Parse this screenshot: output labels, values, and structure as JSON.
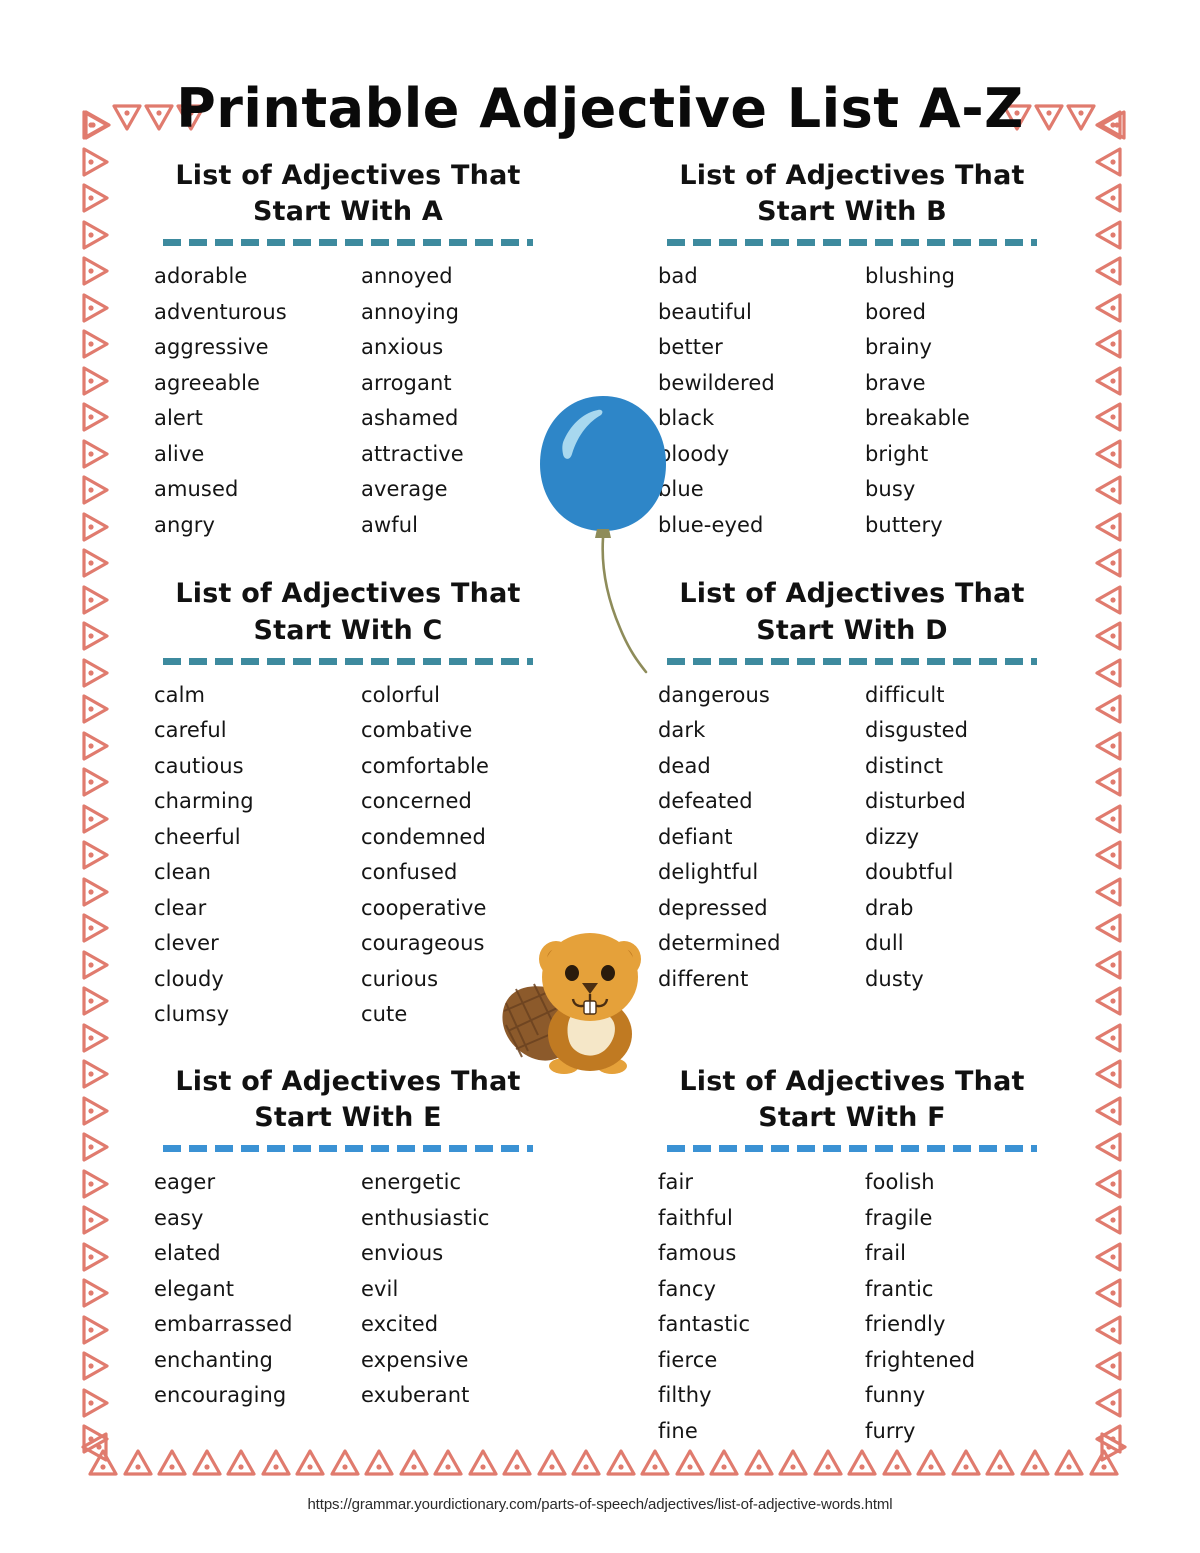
{
  "title": "Printable Adjective List A-Z",
  "footer": {
    "url": "https://grammar.yourdictionary.com/parts-of-speech/adjectives/list-of-adjective-words.html"
  },
  "colors": {
    "border": "#E07B6E",
    "divider_teal": "#3D8A9E",
    "divider_blue": "#3B92D4",
    "balloon": "#2E86C8",
    "balloon_highlight": "#A8D8EF",
    "balloon_string": "#8E8C5A",
    "beaver_body": "#E5A13A",
    "beaver_tail": "#8C5A2B",
    "beaver_belly": "#F5E7C8",
    "text": "#151515"
  },
  "sections": [
    {
      "heading_line1": "List of Adjectives That",
      "heading_line2": "Start With A",
      "letter": "A",
      "divider_color": "#3D8A9E",
      "col1": [
        "adorable",
        "adventurous",
        "aggressive",
        "agreeable",
        "alert",
        "alive",
        "amused",
        "angry"
      ],
      "col2": [
        "annoyed",
        "annoying",
        "anxious",
        "arrogant",
        "ashamed",
        "attractive",
        "average",
        "awful"
      ]
    },
    {
      "heading_line1": "List of Adjectives That",
      "heading_line2": "Start With B",
      "letter": "B",
      "divider_color": "#3D8A9E",
      "col1": [
        "bad",
        "beautiful",
        "better",
        "bewildered",
        "black",
        "bloody",
        "blue",
        "blue-eyed"
      ],
      "col2": [
        "blushing",
        "bored",
        "brainy",
        "brave",
        "breakable",
        "bright",
        "busy",
        "buttery"
      ]
    },
    {
      "heading_line1": "List of Adjectives That",
      "heading_line2": "Start With C",
      "letter": "C",
      "divider_color": "#3D8A9E",
      "col1": [
        "calm",
        "careful",
        "cautious",
        "charming",
        "cheerful",
        "clean",
        "clear",
        "clever",
        "cloudy",
        "clumsy"
      ],
      "col2": [
        "colorful",
        "combative",
        "comfortable",
        "concerned",
        "condemned",
        "confused",
        "cooperative",
        "courageous",
        "curious",
        "cute"
      ]
    },
    {
      "heading_line1": "List of Adjectives That",
      "heading_line2": "Start With D",
      "letter": "D",
      "divider_color": "#3D8A9E",
      "col1": [
        "dangerous",
        "dark",
        "dead",
        "defeated",
        "defiant",
        "delightful",
        "depressed",
        "determined",
        "different"
      ],
      "col2": [
        "difficult",
        "disgusted",
        "distinct",
        "disturbed",
        "dizzy",
        "doubtful",
        "drab",
        "dull",
        "dusty"
      ]
    },
    {
      "heading_line1": "List of Adjectives That",
      "heading_line2": "Start With E",
      "letter": "E",
      "divider_color": "#3B92D4",
      "col1": [
        "eager",
        "easy",
        "elated",
        "elegant",
        "embarrassed",
        "enchanting",
        "encouraging"
      ],
      "col2": [
        "energetic",
        "enthusiastic",
        "envious",
        "evil",
        "excited",
        "expensive",
        "exuberant"
      ]
    },
    {
      "heading_line1": "List of Adjectives That",
      "heading_line2": "Start With F",
      "letter": "F",
      "divider_color": "#3B92D4",
      "col1": [
        "fair",
        "faithful",
        "famous",
        "fancy",
        "fantastic",
        "fierce",
        "filthy",
        "fine"
      ],
      "col2": [
        "foolish",
        "fragile",
        "frail",
        "frantic",
        "friendly",
        "frightened",
        "funny",
        "furry"
      ]
    }
  ],
  "decorations": {
    "balloon_label": "blue-balloon-illustration",
    "beaver_label": "beaver-illustration",
    "border_label": "triangle-border-pattern"
  }
}
